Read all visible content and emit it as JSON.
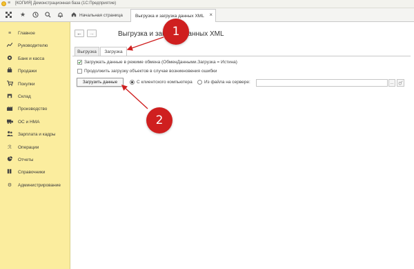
{
  "app": {
    "title": "[КОПИЯ] Демонстрационная база (1С:Предприятие)",
    "logo": "1С",
    "menu_icon": "menu-icon"
  },
  "toolbar": {
    "icons": [
      "apps-grid-icon",
      "star-icon",
      "history-icon",
      "search-icon",
      "bell-icon"
    ]
  },
  "tabs": {
    "home_label": "Начальная страница",
    "active_label": "Выгрузка и загрузка данных XML"
  },
  "sidebar": {
    "background": "#fbed9e",
    "items": [
      {
        "label": "Главное",
        "icon": "menu-icon"
      },
      {
        "label": "Руководителю",
        "icon": "chart-icon"
      },
      {
        "label": "Банк и касса",
        "icon": "coins-icon"
      },
      {
        "label": "Продажи",
        "icon": "sales-icon"
      },
      {
        "label": "Покупки",
        "icon": "cart-icon"
      },
      {
        "label": "Склад",
        "icon": "warehouse-icon"
      },
      {
        "label": "Производство",
        "icon": "factory-icon"
      },
      {
        "label": "ОС и НМА",
        "icon": "assets-icon"
      },
      {
        "label": "Зарплата и кадры",
        "icon": "people-icon"
      },
      {
        "label": "Операции",
        "icon": "operations-icon"
      },
      {
        "label": "Отчеты",
        "icon": "reports-icon"
      },
      {
        "label": "Справочники",
        "icon": "books-icon"
      },
      {
        "label": "Администрирование",
        "icon": "gear-icon"
      }
    ]
  },
  "form": {
    "title": "Выгрузка и загрузка данных XML",
    "tabs": [
      "Выгрузка",
      "Загрузка"
    ],
    "selected_tab": "Загрузка",
    "exchange_mode_label": "Загружать данные в режиме обмена (ОбменДанными.Загрузка = Истина)",
    "exchange_mode_checked": true,
    "continue_on_error_label": "Продолжить загрузку объектов в случае возникновения ошибки",
    "continue_on_error_checked": false,
    "load_button": "Загрузить данные",
    "radio_client": "С клиентского компьютера",
    "radio_client_selected": true,
    "radio_server": "Из файла на сервере:",
    "server_path_value": "",
    "browse_button": "...",
    "open_icon": "open-file-icon"
  },
  "annotations": [
    {
      "label": "1",
      "color": "#cf1f1f",
      "points_to": "Загрузка"
    },
    {
      "label": "2",
      "color": "#cf1f1f",
      "points_to": "Загрузить данные"
    }
  ]
}
